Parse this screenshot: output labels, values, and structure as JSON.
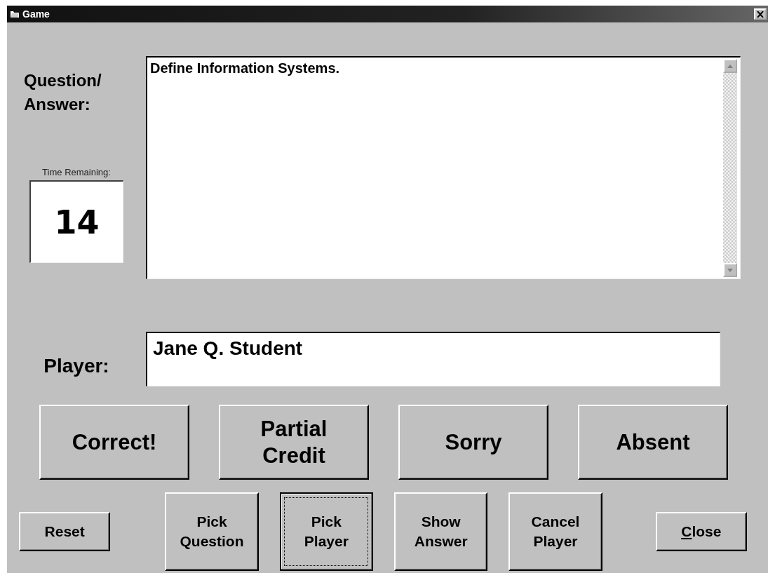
{
  "window": {
    "title": "Game"
  },
  "question_label": "Question/ Answer:",
  "question_text": "Define Information Systems.",
  "timer": {
    "label": "Time Remaining:",
    "value": "14"
  },
  "player": {
    "label": "Player:",
    "value": "Jane Q. Student"
  },
  "score_buttons": [
    {
      "label": "Correct!"
    },
    {
      "label": "Partial Credit"
    },
    {
      "label": "Sorry"
    },
    {
      "label": "Absent"
    }
  ],
  "control_buttons": [
    {
      "label": "Reset",
      "kind": "short",
      "focused": false,
      "underline_first": false
    },
    {
      "label": "Pick Question",
      "kind": "tall",
      "focused": false,
      "underline_first": false
    },
    {
      "label": "Pick Player",
      "kind": "tall",
      "focused": true,
      "underline_first": false
    },
    {
      "label": "Show Answer",
      "kind": "tall",
      "focused": false,
      "underline_first": false
    },
    {
      "label": "Cancel Player",
      "kind": "tall",
      "focused": false,
      "underline_first": false
    },
    {
      "label": "Close",
      "kind": "short",
      "focused": false,
      "underline_first": true
    }
  ]
}
